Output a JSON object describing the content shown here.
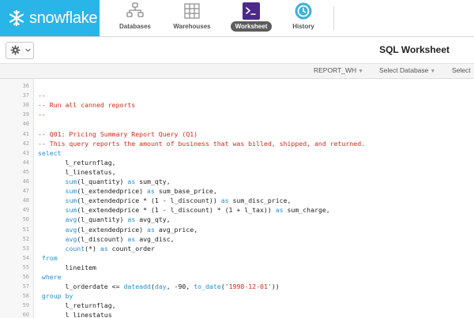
{
  "nav": {
    "brand": "snowflake",
    "items": [
      {
        "label": "Databases",
        "icon": "databases-icon"
      },
      {
        "label": "Warehouses",
        "icon": "warehouses-icon"
      },
      {
        "label": "Worksheet",
        "icon": "worksheet-icon",
        "active": true
      },
      {
        "label": "History",
        "icon": "history-icon"
      }
    ]
  },
  "header": {
    "title": "SQL Worksheet"
  },
  "context": {
    "warehouse": "REPORT_WH",
    "database": "Select Database",
    "schema": "Select"
  },
  "colors": {
    "brand": "#29b5e8",
    "comment": "#d62a1c",
    "keyword": "#2a8fcf"
  },
  "editor": {
    "lines": [
      {
        "n": "36",
        "tokens": []
      },
      {
        "n": "37",
        "tokens": [
          {
            "t": "--",
            "c": "comment"
          }
        ]
      },
      {
        "n": "38",
        "tokens": [
          {
            "t": "-- Run all canned reports",
            "c": "comment"
          }
        ]
      },
      {
        "n": "39",
        "tokens": [
          {
            "t": "--",
            "c": "comment"
          }
        ]
      },
      {
        "n": "40",
        "tokens": []
      },
      {
        "n": "41",
        "tokens": [
          {
            "t": "-- Q01: Pricing Summary Report Query (Q1)",
            "c": "comment"
          }
        ]
      },
      {
        "n": "42",
        "tokens": [
          {
            "t": "-- This query reports the amount of business that was billed, shipped, and returned.",
            "c": "comment"
          }
        ]
      },
      {
        "n": "43",
        "tokens": [
          {
            "t": "select",
            "c": "kw"
          }
        ]
      },
      {
        "n": "44",
        "tokens": [
          {
            "t": "       l_returnflag,",
            "c": "plain"
          }
        ]
      },
      {
        "n": "45",
        "tokens": [
          {
            "t": "       l_linestatus,",
            "c": "plain"
          }
        ]
      },
      {
        "n": "46",
        "tokens": [
          {
            "t": "       ",
            "c": "plain"
          },
          {
            "t": "sum",
            "c": "fn"
          },
          {
            "t": "(l_quantity) ",
            "c": "plain"
          },
          {
            "t": "as",
            "c": "kw"
          },
          {
            "t": " sum_qty,",
            "c": "plain"
          }
        ]
      },
      {
        "n": "47",
        "tokens": [
          {
            "t": "       ",
            "c": "plain"
          },
          {
            "t": "sum",
            "c": "fn"
          },
          {
            "t": "(l_extendedprice) ",
            "c": "plain"
          },
          {
            "t": "as",
            "c": "kw"
          },
          {
            "t": " sum_base_price,",
            "c": "plain"
          }
        ]
      },
      {
        "n": "48",
        "tokens": [
          {
            "t": "       ",
            "c": "plain"
          },
          {
            "t": "sum",
            "c": "fn"
          },
          {
            "t": "(l_extendedprice * (1 - l_discount)) ",
            "c": "plain"
          },
          {
            "t": "as",
            "c": "kw"
          },
          {
            "t": " sum_disc_price,",
            "c": "plain"
          }
        ]
      },
      {
        "n": "49",
        "tokens": [
          {
            "t": "       ",
            "c": "plain"
          },
          {
            "t": "sum",
            "c": "fn"
          },
          {
            "t": "(l_extendedprice * (1 - l_discount) * (1 + l_tax)) ",
            "c": "plain"
          },
          {
            "t": "as",
            "c": "kw"
          },
          {
            "t": " sum_charge,",
            "c": "plain"
          }
        ]
      },
      {
        "n": "50",
        "tokens": [
          {
            "t": "       ",
            "c": "plain"
          },
          {
            "t": "avg",
            "c": "fn"
          },
          {
            "t": "(l_quantity) ",
            "c": "plain"
          },
          {
            "t": "as",
            "c": "kw"
          },
          {
            "t": " avg_qty,",
            "c": "plain"
          }
        ]
      },
      {
        "n": "51",
        "tokens": [
          {
            "t": "       ",
            "c": "plain"
          },
          {
            "t": "avg",
            "c": "fn"
          },
          {
            "t": "(l_extendedprice) ",
            "c": "plain"
          },
          {
            "t": "as",
            "c": "kw"
          },
          {
            "t": " avg_price,",
            "c": "plain"
          }
        ]
      },
      {
        "n": "52",
        "tokens": [
          {
            "t": "       ",
            "c": "plain"
          },
          {
            "t": "avg",
            "c": "fn"
          },
          {
            "t": "(l_discount) ",
            "c": "plain"
          },
          {
            "t": "as",
            "c": "kw"
          },
          {
            "t": " avg_disc,",
            "c": "plain"
          }
        ]
      },
      {
        "n": "53",
        "tokens": [
          {
            "t": "       ",
            "c": "plain"
          },
          {
            "t": "count",
            "c": "fn"
          },
          {
            "t": "(*) ",
            "c": "plain"
          },
          {
            "t": "as",
            "c": "kw"
          },
          {
            "t": " count_order",
            "c": "plain"
          }
        ]
      },
      {
        "n": "54",
        "tokens": [
          {
            "t": " from",
            "c": "kw"
          }
        ]
      },
      {
        "n": "55",
        "tokens": [
          {
            "t": "       lineitem",
            "c": "plain"
          }
        ]
      },
      {
        "n": "56",
        "tokens": [
          {
            "t": " where",
            "c": "kw"
          }
        ]
      },
      {
        "n": "57",
        "tokens": [
          {
            "t": "       l_orderdate <= ",
            "c": "plain"
          },
          {
            "t": "dateadd",
            "c": "fn"
          },
          {
            "t": "(",
            "c": "plain"
          },
          {
            "t": "day",
            "c": "kw"
          },
          {
            "t": ", -90, ",
            "c": "plain"
          },
          {
            "t": "to_date",
            "c": "fn"
          },
          {
            "t": "(",
            "c": "plain"
          },
          {
            "t": "'1998-12-01'",
            "c": "str"
          },
          {
            "t": "))",
            "c": "plain"
          }
        ]
      },
      {
        "n": "58",
        "tokens": [
          {
            "t": " group by",
            "c": "kw"
          }
        ]
      },
      {
        "n": "59",
        "tokens": [
          {
            "t": "       l_returnflag,",
            "c": "plain"
          }
        ]
      },
      {
        "n": "60",
        "tokens": [
          {
            "t": "       l_linestatus",
            "c": "plain"
          }
        ]
      }
    ]
  }
}
